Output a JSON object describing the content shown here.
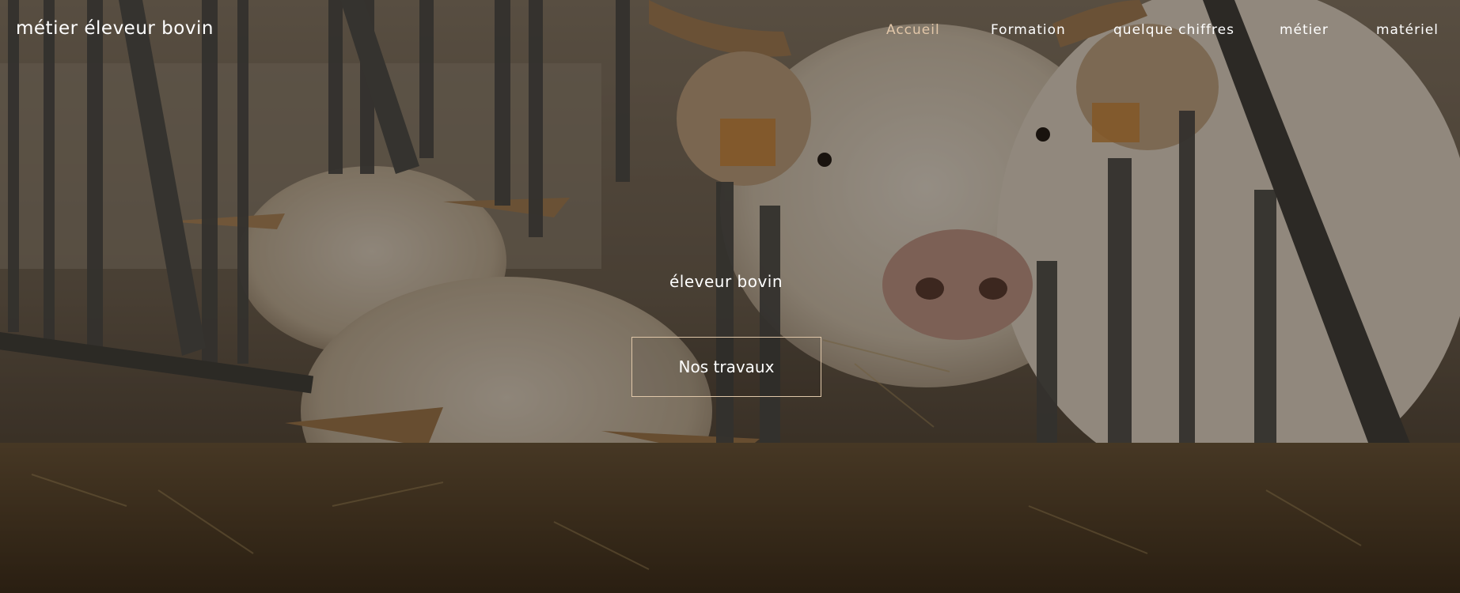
{
  "nav": {
    "brand": "métier éleveur bovin",
    "links": [
      {
        "label": "Accueil",
        "active": true
      },
      {
        "label": "Formation",
        "active": false
      },
      {
        "label": "quelque chiffres",
        "active": false
      },
      {
        "label": "métier",
        "active": false
      },
      {
        "label": "matériel",
        "active": false
      }
    ]
  },
  "hero": {
    "tagline": "éleveur bovin",
    "cta_label": "Nos travaux"
  },
  "colors": {
    "accent": "#e1c6a8",
    "text": "#ffffff",
    "overlay": "#120e0a"
  },
  "icons": {
    "background": "hero-photo-cows"
  }
}
